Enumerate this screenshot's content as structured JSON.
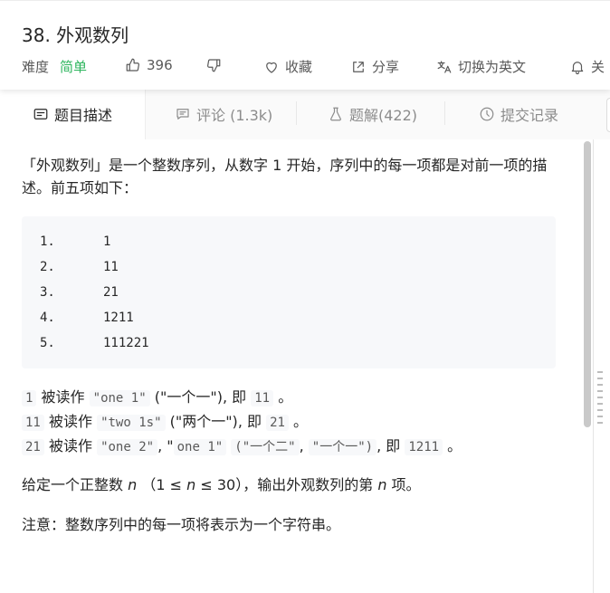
{
  "problem": {
    "title": "38. 外观数列",
    "difficulty_label": "难度",
    "difficulty": "简单",
    "likes": "396",
    "favorite_label": "收藏",
    "share_label": "分享",
    "switch_lang_label": "切换为英文",
    "follow_label": "关"
  },
  "tabs": [
    {
      "label": "题目描述",
      "icon": "description-icon"
    },
    {
      "label": "评论 (1.3k)",
      "icon": "comment-icon"
    },
    {
      "label": "题解(422)",
      "icon": "flask-icon"
    },
    {
      "label": "提交记录",
      "icon": "clock-icon"
    }
  ],
  "description": {
    "intro": "「外观数列」是一个整数序列，从数字 1 开始，序列中的每一项都是对前一项的描述。前五项如下：",
    "sequence": [
      {
        "num": "1.",
        "value": "1"
      },
      {
        "num": "2.",
        "value": "11"
      },
      {
        "num": "3.",
        "value": "21"
      },
      {
        "num": "4.",
        "value": "1211"
      },
      {
        "num": "5.",
        "value": "111221"
      }
    ],
    "examples": [
      {
        "a": "1",
        "verb": "被读作",
        "b": "\"one 1\"",
        "c": "(\"一个一\")",
        "d": ", 即",
        "e": "11",
        "f": "。"
      },
      {
        "a": "11",
        "verb": "被读作",
        "b": "\"two 1s\"",
        "c": "(\"两个一\")",
        "d": ", 即",
        "e": "21",
        "f": "。"
      },
      {
        "a": "21",
        "verb": "被读作",
        "b": "\"one 2\"",
        "sep": ", \"",
        "b2": "one 1\"",
        "c": "(\"一个二\"",
        "c_sep": ",",
        "c2": "\"一个一\")",
        "d": ", 即",
        "e": "1211",
        "f": "。"
      }
    ],
    "given_prefix": "给定一个正整数",
    "n_var": "n",
    "given_range": "（1 ≤",
    "given_range2": "≤ 30），输出外观数列的第",
    "given_suffix": "项。",
    "note": "注意：整数序列中的每一项将表示为一个字符串。"
  },
  "colors": {
    "easy": "#2db55d",
    "text": "#262626",
    "muted": "#8c8c8c",
    "code_bg": "#f7f8fa"
  }
}
